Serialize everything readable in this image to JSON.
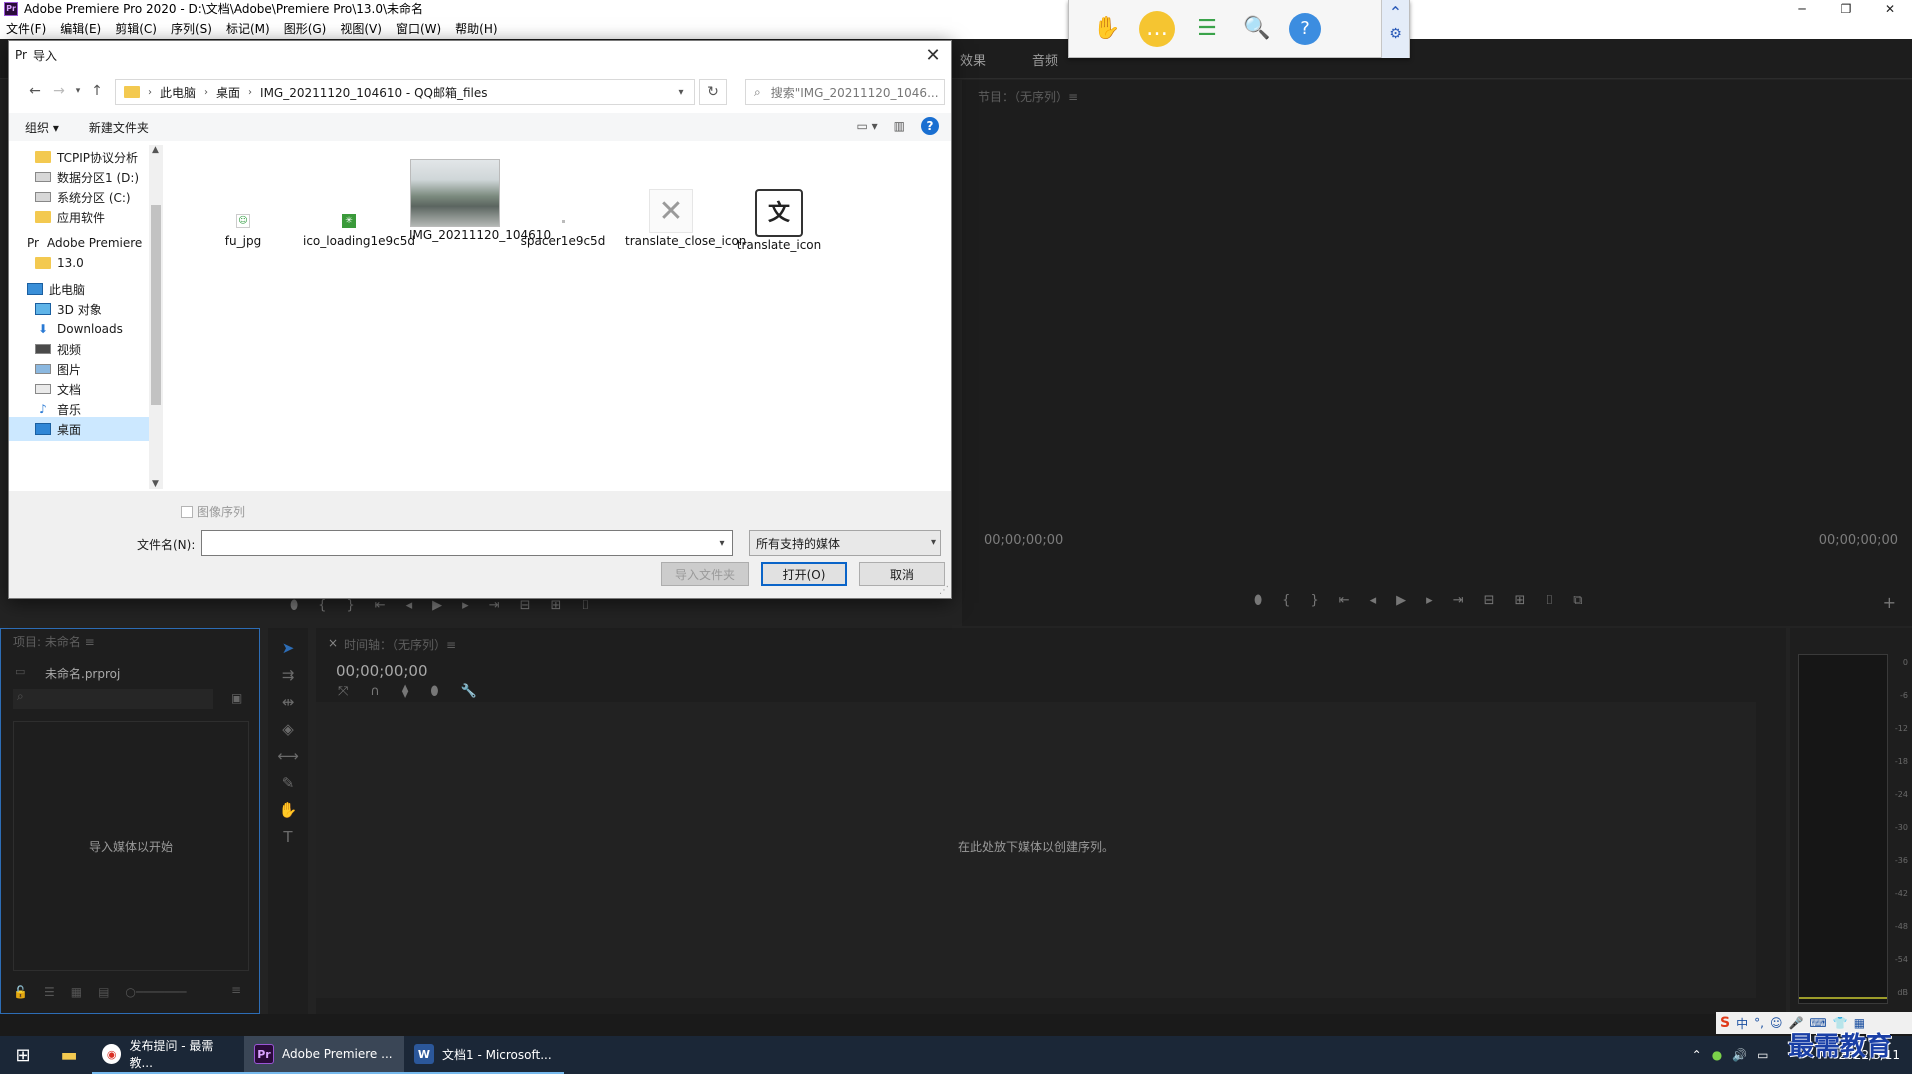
{
  "app": {
    "title": "Adobe Premiere Pro 2020 - D:\\文档\\Adobe\\Premiere Pro\\13.0\\未命名",
    "menu": [
      "文件(F)",
      "编辑(E)",
      "剪辑(C)",
      "序列(S)",
      "标记(M)",
      "图形(G)",
      "视图(V)",
      "窗口(W)",
      "帮助(H)"
    ],
    "workspace_tabs": [
      "效果",
      "音频"
    ],
    "program_monitor": {
      "title": "节目：（无序列）≡",
      "timecode_left": "00;00;00;00",
      "timecode_right": "00;00;00;00"
    },
    "project": {
      "title": "项目: 未命名 ≡",
      "file": "未命名.prproj",
      "placeholder": "导入媒体以开始"
    },
    "timeline": {
      "close": "×",
      "title": "时间轴：（无序列）≡",
      "timecode": "00;00;00;00",
      "drop_hint": "在此处放下媒体以创建序列。"
    },
    "meter_db": [
      "0",
      "-6",
      "-12",
      "-18",
      "-24",
      "-30",
      "-36",
      "-42",
      "-48",
      "-54",
      "dB"
    ]
  },
  "dialog": {
    "title": "导入",
    "breadcrumb": [
      "此电脑",
      "桌面",
      "IMG_20211120_104610 - QQ邮箱_files"
    ],
    "search_placeholder": "搜索\"IMG_20211120_1046...",
    "organize": "组织 ▾",
    "new_folder": "新建文件夹",
    "nav_items": [
      {
        "label": "TCPIP协议分析",
        "icon": "folder"
      },
      {
        "label": "数据分区1 (D:)",
        "icon": "drive"
      },
      {
        "label": "系统分区 (C:)",
        "icon": "drive"
      },
      {
        "label": "应用软件",
        "icon": "folder"
      },
      {
        "label": "Adobe Premiere",
        "icon": "premiere"
      },
      {
        "label": "13.0",
        "icon": "folder"
      },
      {
        "label": "此电脑",
        "icon": "pc"
      },
      {
        "label": "3D 对象",
        "icon": "3d"
      },
      {
        "label": "Downloads",
        "icon": "download"
      },
      {
        "label": "视频",
        "icon": "video"
      },
      {
        "label": "图片",
        "icon": "picture"
      },
      {
        "label": "文档",
        "icon": "document"
      },
      {
        "label": "音乐",
        "icon": "music"
      },
      {
        "label": "桌面",
        "icon": "desktop"
      }
    ],
    "files": [
      {
        "name": "fu_jpg"
      },
      {
        "name": "ico_loading1e9c5d"
      },
      {
        "name": "IMG_20211120_104610"
      },
      {
        "name": "spacer1e9c5d"
      },
      {
        "name": "translate_close_icon"
      },
      {
        "name": "translate_icon"
      }
    ],
    "image_sequence": "图像序列",
    "filename_label": "文件名(N):",
    "filename_value": "",
    "filetype": "所有支持的媒体",
    "btn_import_folder": "导入文件夹",
    "btn_open": "打开(O)",
    "btn_cancel": "取消"
  },
  "taskbar": {
    "apps": [
      "发布提问 - 最需教...",
      "Adobe Premiere ...",
      "文档1 - Microsoft..."
    ],
    "date": "2022/3/11"
  },
  "ime": {
    "lang": "中"
  },
  "watermark": "最需教育"
}
